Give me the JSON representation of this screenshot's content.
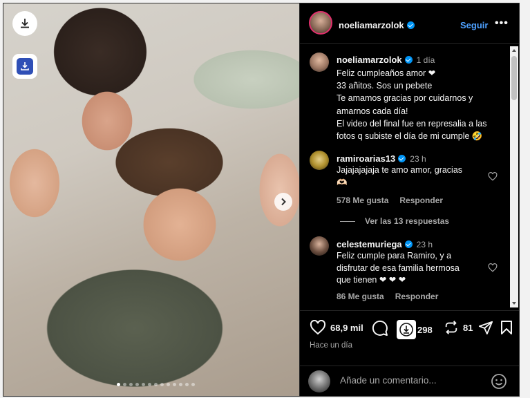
{
  "post": {
    "username": "noeliamarzolok",
    "follow_label": "Seguir",
    "more_label": "•••"
  },
  "caption": {
    "username": "noeliamarzolok",
    "time": "1 día",
    "lines": [
      "Feliz cumpleaños amor ❤",
      "33 añitos. Sos un pebete",
      "Te amamos gracias por cuidarnos y",
      "amarnos cada día!",
      "El video del final fue en represalia a las",
      "fotos q subiste el día de mi cumple 🤣"
    ]
  },
  "comments": [
    {
      "username": "ramiroarias13",
      "time": "23 h",
      "text_lines": [
        "Jajajajajaja te amo amor, gracias",
        "🫶🏻"
      ],
      "likes": "578 Me gusta",
      "reply": "Responder"
    },
    {
      "username": "celestemuriega",
      "time": "23 h",
      "text_lines": [
        "Feliz cumple para Ramiro, y a",
        "disfrutar de esa familia hermosa",
        "que tienen ❤ ❤ ❤"
      ],
      "likes": "86 Me gusta",
      "reply": "Responder"
    }
  ],
  "view_replies": "Ver las 13 respuestas",
  "actions": {
    "likes": "68,9 mil",
    "comments": "298",
    "shares": "81",
    "posted": "Hace un día"
  },
  "add_comment": {
    "placeholder": "Añade un comentario..."
  },
  "carousel": {
    "dots": 13,
    "active": 0
  }
}
